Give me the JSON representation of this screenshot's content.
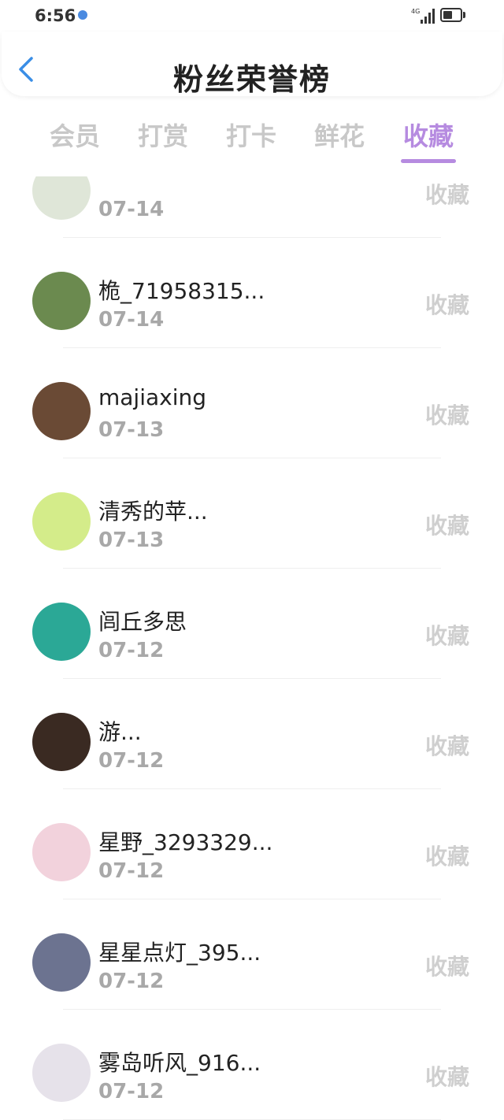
{
  "status_bar": {
    "time": "6:56",
    "network": "4G",
    "battery_level": 0.55
  },
  "header": {
    "title": "粉丝荣誉榜",
    "back_icon": "chevron-left-icon",
    "accent_color": "#3a8ee6"
  },
  "tabs": [
    {
      "label": "会员",
      "active": false
    },
    {
      "label": "打赏",
      "active": false
    },
    {
      "label": "打卡",
      "active": false
    },
    {
      "label": "鲜花",
      "active": false
    },
    {
      "label": "收藏",
      "active": true
    }
  ],
  "active_tab_color": "#b68be0",
  "list": [
    {
      "name": "",
      "date": "07-14",
      "action": "收藏",
      "avatar_color": "#dfe6d8"
    },
    {
      "name": "桅_71958315...",
      "date": "07-14",
      "action": "收藏",
      "avatar_color": "#6b8a4f"
    },
    {
      "name": "majiaxing",
      "date": "07-13",
      "action": "收藏",
      "avatar_color": "#6a4a35"
    },
    {
      "name": "清秀的苹...",
      "date": "07-13",
      "action": "收藏",
      "avatar_color": "#d4ec8a"
    },
    {
      "name": "闾丘多思",
      "date": "07-12",
      "action": "收藏",
      "avatar_color": "#2ba896"
    },
    {
      "name": "游...",
      "date": "07-12",
      "action": "收藏",
      "avatar_color": "#3a2a22"
    },
    {
      "name": "星野_3293329...",
      "date": "07-12",
      "action": "收藏",
      "avatar_color": "#f2d2dc"
    },
    {
      "name": "星星点灯_395...",
      "date": "07-12",
      "action": "收藏",
      "avatar_color": "#6c7390"
    },
    {
      "name": "雾岛听风_916...",
      "date": "07-12",
      "action": "收藏",
      "avatar_color": "#e6e2ea"
    }
  ]
}
